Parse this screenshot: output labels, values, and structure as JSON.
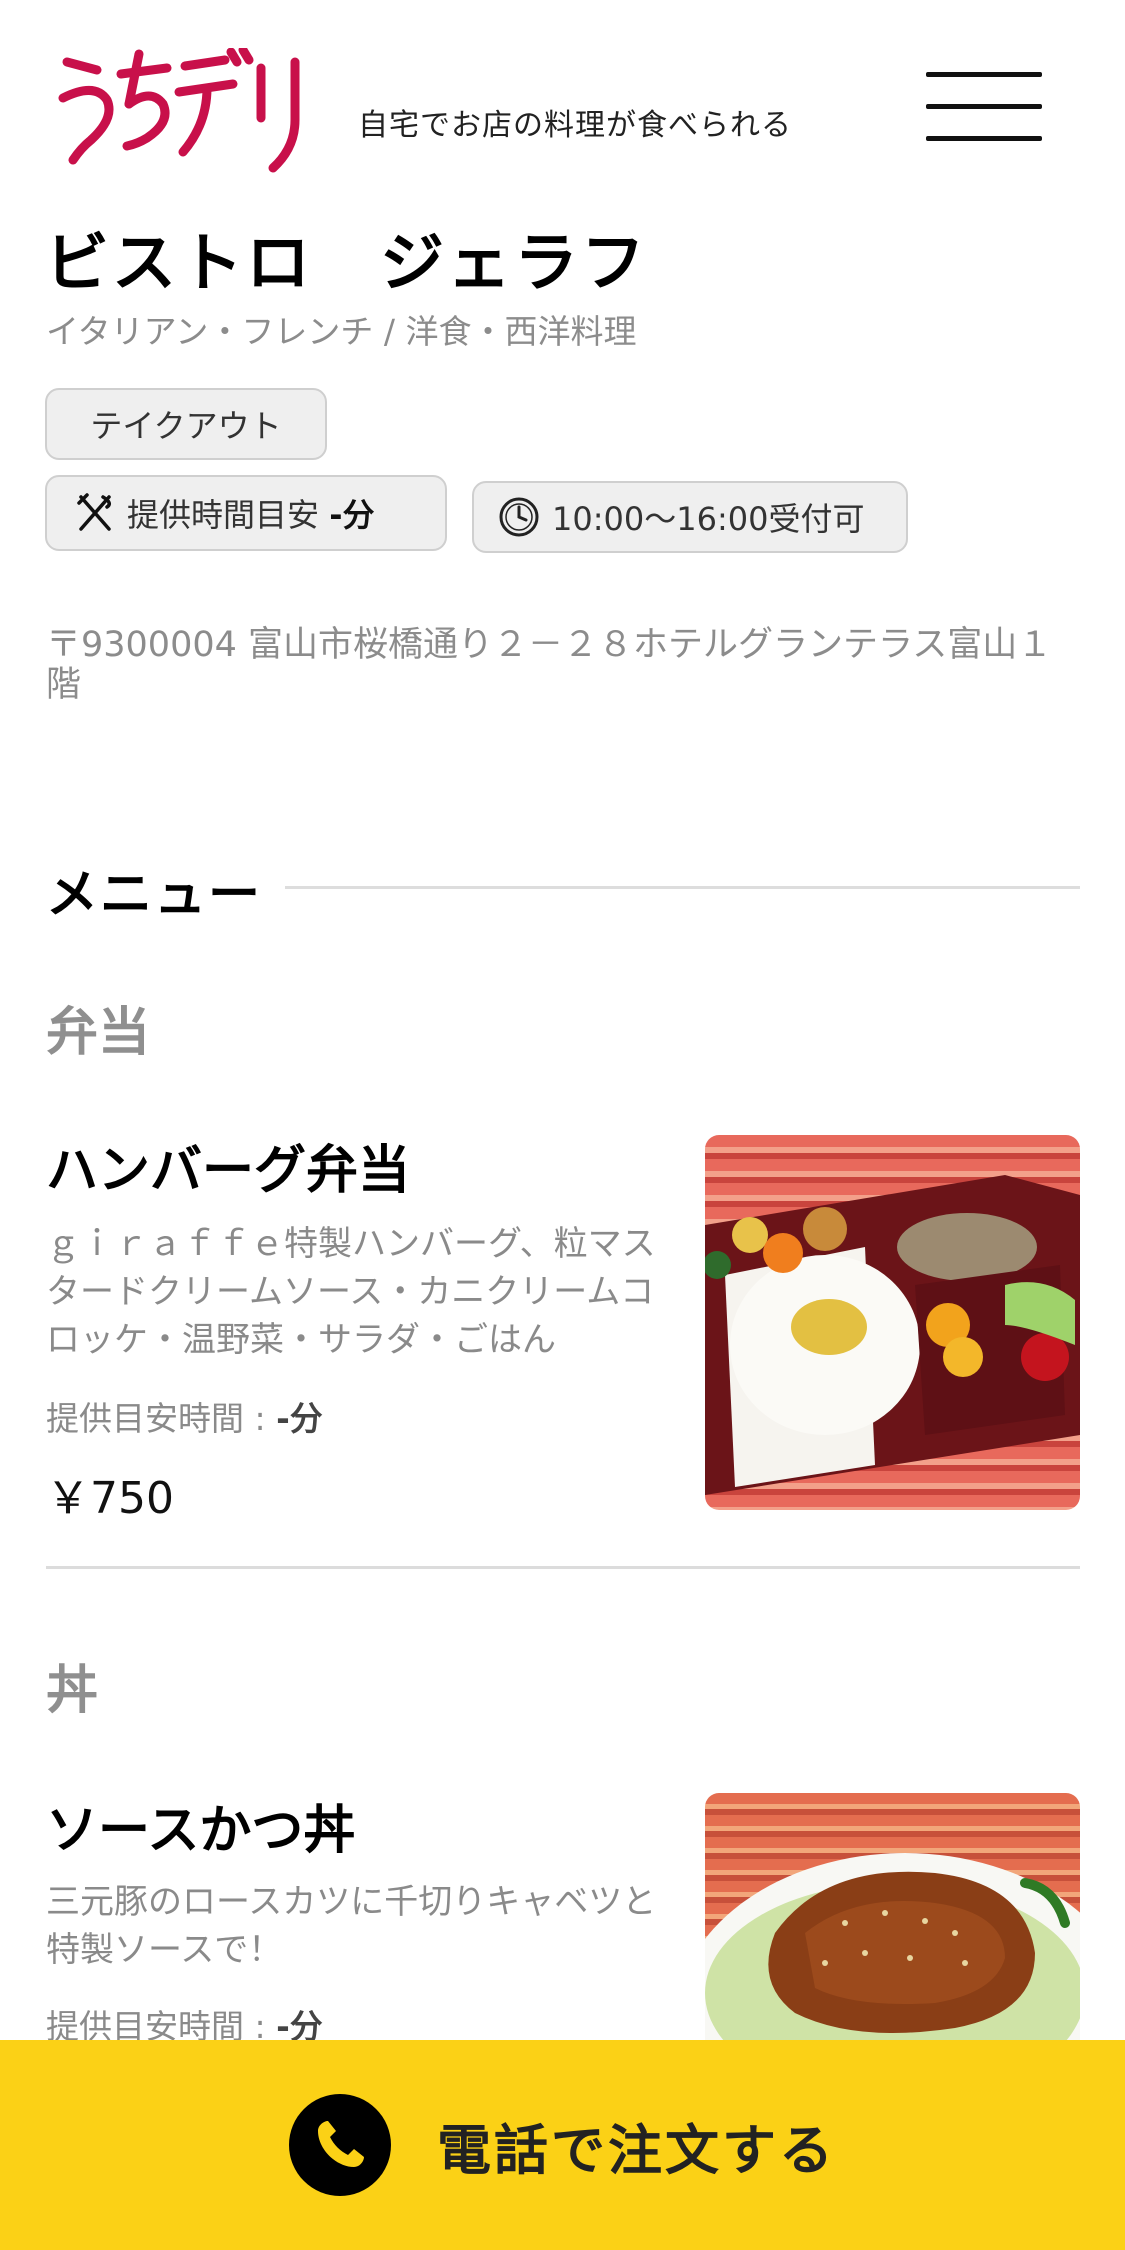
{
  "header": {
    "logo_text": "うちデリ",
    "tagline": "自宅でお店の料理が食べられる",
    "menu_icon": "hamburger-icon"
  },
  "shop": {
    "name": "ビストロ　ジェラフ",
    "genre": "イタリアン・フレンチ / 洋食・西洋料理",
    "tag_takeout": "テイクアウト",
    "prep_time_label": "提供時間目安",
    "prep_time_value": "-分",
    "hours": "10:00〜16:00受付可",
    "address": "〒9300004 富山市桜橋通り２－２８ホテルグランテラス富山１階"
  },
  "menu": {
    "heading": "メニュー",
    "categories": [
      {
        "title": "弁当",
        "items": [
          {
            "name": "ハンバーグ弁当",
            "description": "ｇｉｒａｆｆｅ特製ハンバーグ、粒マスタードクリームソース・カニクリームコロッケ・温野菜・サラダ・ごはん",
            "time_label": "提供目安時間 : ",
            "time_value": "-分",
            "price": "￥750"
          }
        ]
      },
      {
        "title": "丼",
        "items": [
          {
            "name": "ソースかつ丼",
            "description": "三元豚のロースカツに千切りキャベツと特製ソースで！",
            "time_label": "提供目安時間 : ",
            "time_value": "-分"
          }
        ]
      }
    ]
  },
  "cta": {
    "label": "電話で注文する",
    "icon": "phone-icon"
  },
  "colors": {
    "brand": "#c8104a",
    "accent": "#fbd116",
    "muted_text": "#8c8c8c"
  }
}
